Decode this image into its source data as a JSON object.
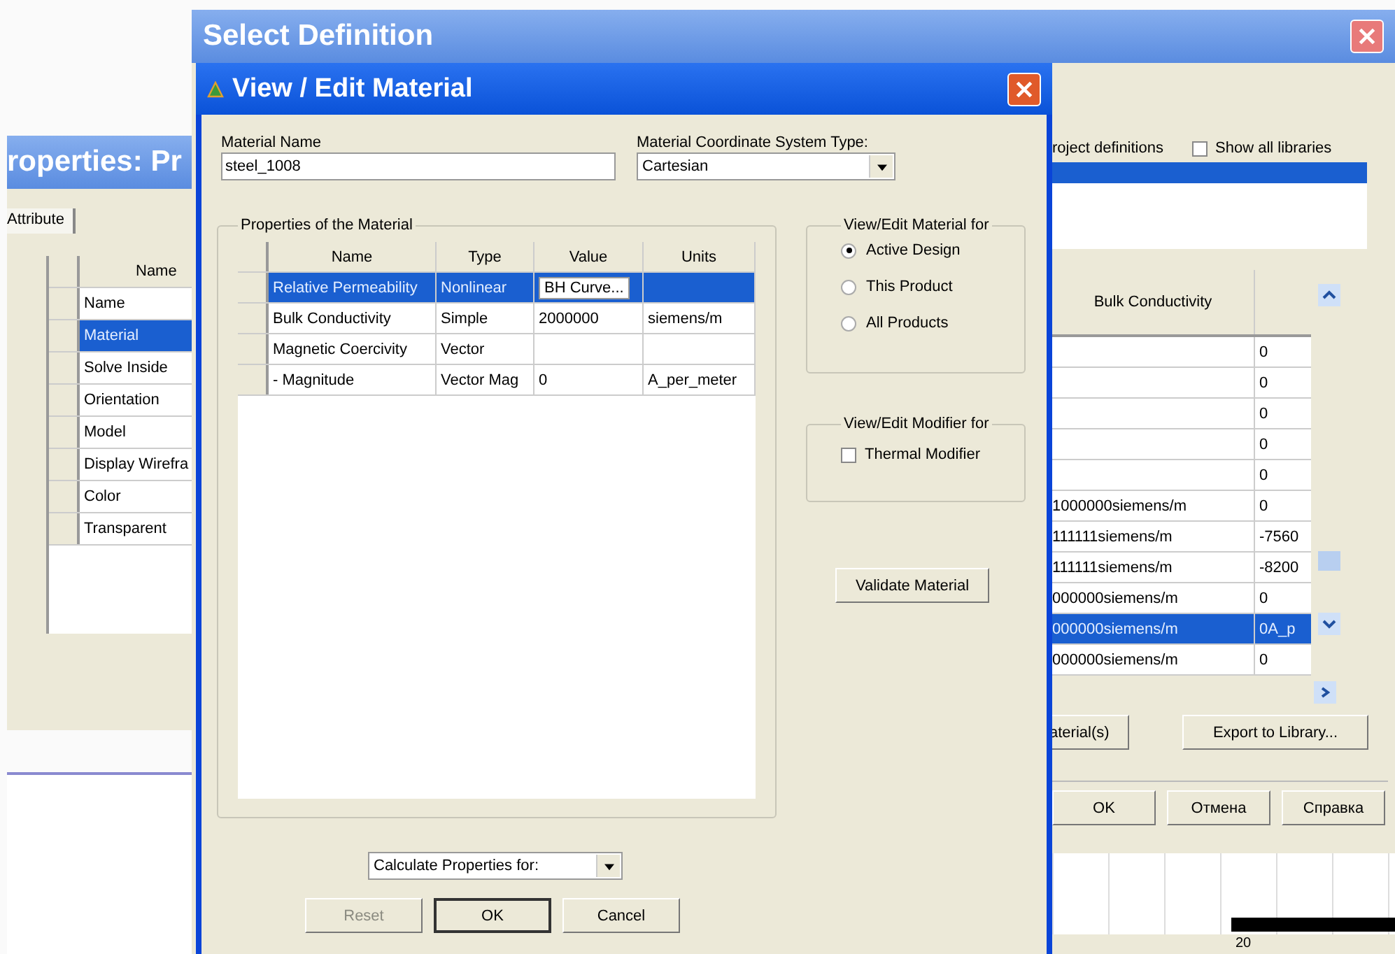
{
  "properties_window": {
    "title": "roperties: Pr",
    "tabs": [
      {
        "label": "Attribute",
        "selected": true
      }
    ],
    "table": {
      "header": "Name",
      "rows": [
        {
          "name": "Name",
          "selected": false
        },
        {
          "name": "Material",
          "selected": true
        },
        {
          "name": "Solve Inside",
          "selected": false
        },
        {
          "name": "Orientation",
          "selected": false
        },
        {
          "name": "Model",
          "selected": false
        },
        {
          "name": "Display Wirefra",
          "selected": false
        },
        {
          "name": "Color",
          "selected": false
        },
        {
          "name": "Transparent",
          "selected": false
        }
      ]
    }
  },
  "select_definition": {
    "title": "Select Definition",
    "filter_label": "roject definitions",
    "show_all_libraries": {
      "label": "Show all libraries",
      "checked": false
    },
    "library_list": [
      {
        "selected": true
      }
    ],
    "table": {
      "columns": [
        "Bulk Conductivity"
      ],
      "rows": [
        {
          "column_2": "0",
          "selected": false
        },
        {
          "column_2": "0",
          "selected": false
        },
        {
          "column_2": "0",
          "selected": false
        },
        {
          "column_2": "0",
          "selected": false
        },
        {
          "column_2": "0",
          "selected": false
        },
        {
          "bulk_conductivity": "1000000siemens/m",
          "column_2": "0",
          "selected": false
        },
        {
          "bulk_conductivity": "111111siemens/m",
          "column_2": "-7560",
          "selected": false
        },
        {
          "bulk_conductivity": "111111siemens/m",
          "column_2": "-8200",
          "selected": false
        },
        {
          "bulk_conductivity": "000000siemens/m",
          "column_2": "0",
          "selected": false
        },
        {
          "bulk_conductivity": "000000siemens/m",
          "column_2": "0A_p",
          "selected": true
        },
        {
          "bulk_conductivity": "000000siemens/m",
          "column_2": "0",
          "selected": false
        }
      ]
    },
    "buttons": [
      "aterial(s)",
      "Export to Library..."
    ],
    "dialog_buttons": [
      "OK",
      "Отмена",
      "Справка"
    ],
    "axis_label": "20"
  },
  "material_dialog": {
    "title": "View / Edit Material",
    "material_name": {
      "label": "Material Name",
      "value": "steel_1008"
    },
    "coordinate_system": {
      "label": "Material Coordinate System Type:",
      "value": "Cartesian"
    },
    "properties": {
      "title": "Properties of the Material",
      "columns": [
        "Name",
        "Type",
        "Value",
        "Units"
      ],
      "rows": [
        {
          "kind": "button",
          "name": "Relative Permeability",
          "type": "Nonlinear",
          "value": "BH Curve...",
          "selected": true
        },
        {
          "kind": "text",
          "name": "Bulk Conductivity",
          "type": "Simple",
          "value": "2000000",
          "units": "siemens/m",
          "selected": false
        },
        {
          "kind": "text",
          "name": "Magnetic Coercivity",
          "type": "Vector",
          "selected": false
        },
        {
          "kind": "text",
          "name": "- Magnitude",
          "type": "Vector Mag",
          "value": "0",
          "units": "A_per_meter",
          "selected": false
        }
      ]
    },
    "view_edit_for": {
      "title": "View/Edit Material for",
      "options": [
        {
          "label": "Active Design",
          "selected": true
        },
        {
          "label": "This Product",
          "selected": false
        },
        {
          "label": "All Products",
          "selected": false
        }
      ]
    },
    "modifier_for": {
      "title": "View/Edit Modifier for",
      "thermal_modifier": {
        "label": "Thermal Modifier",
        "checked": false
      }
    },
    "validate_button": "Validate Material",
    "calculate_select": "Calculate Properties for:",
    "buttons": [
      {
        "label": "Reset",
        "disabled": true,
        "default": false
      },
      {
        "label": "OK",
        "disabled": false,
        "default": true
      },
      {
        "label": "Cancel",
        "disabled": false,
        "default": false
      }
    ]
  }
}
